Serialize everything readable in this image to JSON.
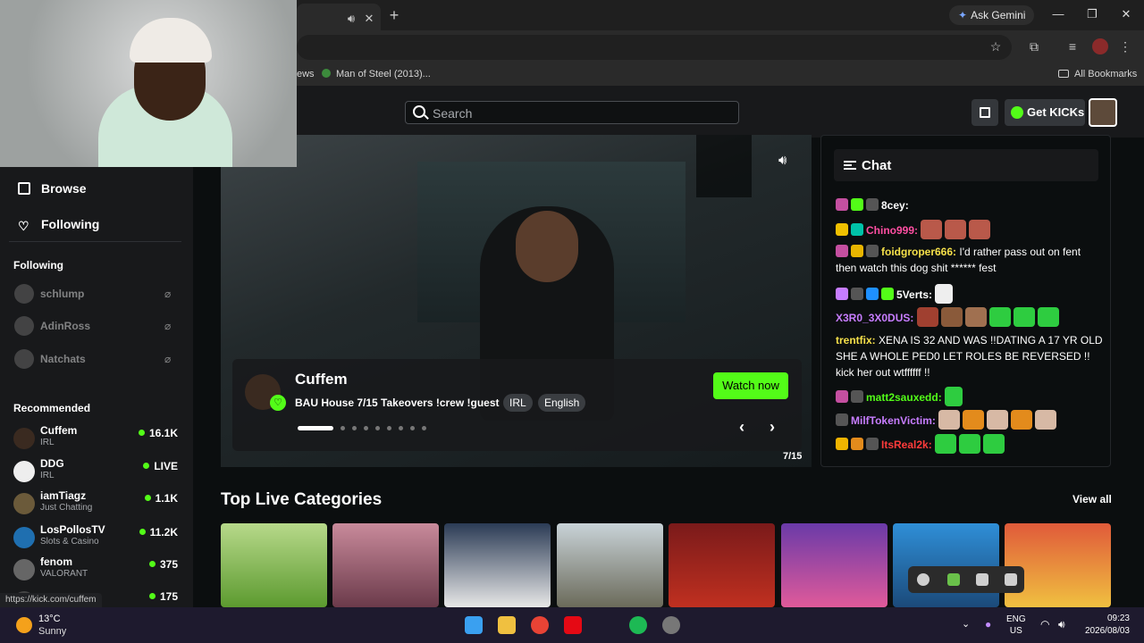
{
  "browser": {
    "ask_gemini": "Ask Gemini",
    "bookmark_news": "ews",
    "bookmark_man_of_steel": "Man of Steel (2013)...",
    "all_bookmarks": "All Bookmarks"
  },
  "site": {
    "search_placeholder": "Search",
    "get_kicks": "Get KICKs",
    "accent": "#53fc18"
  },
  "sidebar": {
    "browse": "Browse",
    "following_nav": "Following",
    "following_heading": "Following",
    "following": [
      {
        "name": "schlump"
      },
      {
        "name": "AdinRoss"
      },
      {
        "name": "Natchats"
      }
    ],
    "recommended_heading": "Recommended",
    "recommended": [
      {
        "name": "Cuffem",
        "category": "IRL",
        "viewers": "16.1K"
      },
      {
        "name": "DDG",
        "category": "IRL",
        "viewers": "LIVE"
      },
      {
        "name": "iamTiagz",
        "category": "Just Chatting",
        "viewers": "1.1K"
      },
      {
        "name": "LosPollosTV",
        "category": "Slots & Casino",
        "viewers": "11.2K"
      },
      {
        "name": "fenom",
        "category": "VALORANT",
        "viewers": "375"
      },
      {
        "name": "",
        "category": "",
        "viewers": "175"
      }
    ]
  },
  "hero": {
    "streamer": "Cuffem",
    "title": "BAU House 7/15 Takeovers !crew !guest",
    "tags": [
      "IRL",
      "English"
    ],
    "watch_now": "Watch now",
    "counter": "7/15"
  },
  "chat": {
    "title": "Chat",
    "messages": [
      {
        "user": "8cey:",
        "text": "",
        "color": "#ffffff"
      },
      {
        "user": "Chino999:",
        "text": "",
        "color": "#ff4fa3"
      },
      {
        "user": "foidgroper666:",
        "text": "I'd rather pass out on fent then watch this dog shit ****** fest",
        "color": "#f5e04a"
      },
      {
        "user": "5Verts:",
        "text": "",
        "color": "#ffffff"
      },
      {
        "user": "X3R0_3X0DUS:",
        "text": "",
        "color": "#c77dff"
      },
      {
        "user": "trentfix:",
        "text": "XENA IS 32 AND WAS !!DATING A 17 YR OLD SHE A WHOLE PED0 LET ROLES BE REVERSED !! kick her out wtffffff !!",
        "color": "#f5e04a"
      },
      {
        "user": "matt2sauxedd:",
        "text": "",
        "color": "#53fc18"
      },
      {
        "user": "MilfTokenVictim:",
        "text": "",
        "color": "#c77dff"
      },
      {
        "user": "ItsReal2k:",
        "text": "",
        "color": "#ff3b3b"
      }
    ]
  },
  "categories": {
    "title": "Top Live Categories",
    "view_all": "View all"
  },
  "status_url": "https://kick.com/cuffem",
  "taskbar": {
    "temp": "13°C",
    "weather": "Sunny",
    "lang1": "ENG",
    "lang2": "US",
    "time": "09:23",
    "date": "2026/08/03"
  }
}
